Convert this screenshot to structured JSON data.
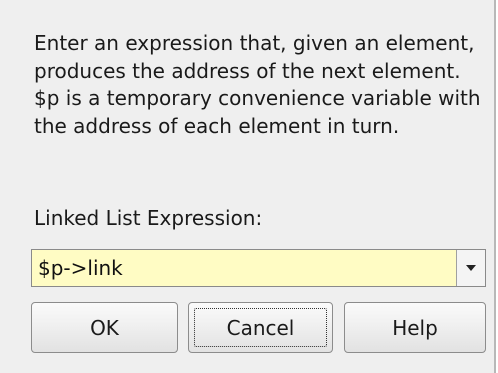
{
  "dialog": {
    "description": "Enter an expression that, given an element, produces the address of the next element.  $p is a temporary convenience variable with the address of each element in turn.",
    "field_label": "Linked List Expression:",
    "expression": {
      "value": "$p->link",
      "dropdown_icon": "chevron-down-icon",
      "background_color": "#fffcc4"
    },
    "buttons": {
      "ok": "OK",
      "cancel": "Cancel",
      "help": "Help"
    },
    "focused_button": "cancel"
  }
}
